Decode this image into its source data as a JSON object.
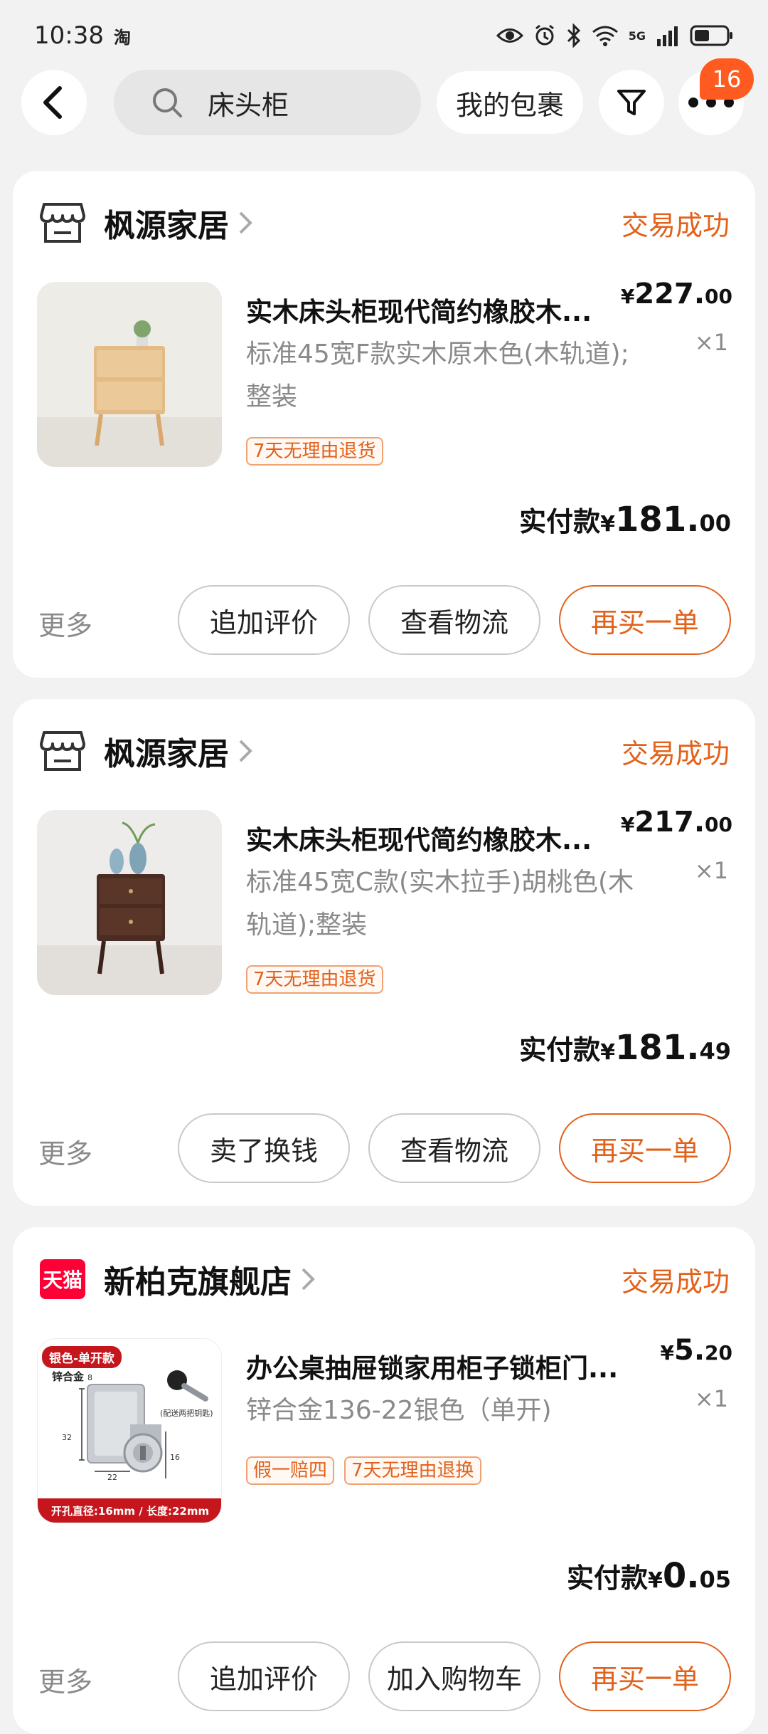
{
  "status_bar": {
    "time": "10:38",
    "app_indicator": "淘",
    "network": "5G",
    "icons": [
      "eye-icon",
      "alarm-icon",
      "bluetooth-icon",
      "wifi-icon",
      "signal-icon",
      "battery-icon"
    ]
  },
  "header": {
    "search_text": "床头柜",
    "my_packages": "我的包裹",
    "badge_count": "16",
    "accent": "#e2611b"
  },
  "orders": [
    {
      "shop_name": "枫源家居",
      "shop_icon": "store-icon",
      "status": "交易成功",
      "product_title": "实木床头柜现代简约橡胶木...",
      "sku": "标准45宽F款实木原木色(木轨道);整装",
      "tags": [
        "7天无理由退货"
      ],
      "price_symbol": "¥",
      "price_int": "227.",
      "price_dec": "00",
      "qty": "×1",
      "paid_label": "实付款",
      "paid_symbol": "¥",
      "paid_int": "181.",
      "paid_dec": "00",
      "more": "更多",
      "actions": [
        "追加评价",
        "查看物流",
        "再买一单"
      ]
    },
    {
      "shop_name": "枫源家居",
      "shop_icon": "store-icon",
      "status": "交易成功",
      "product_title": "实木床头柜现代简约橡胶木...",
      "sku": "标准45宽C款(实木拉手)胡桃色(木轨道);整装",
      "tags": [
        "7天无理由退货"
      ],
      "price_symbol": "¥",
      "price_int": "217.",
      "price_dec": "00",
      "qty": "×1",
      "paid_label": "实付款",
      "paid_symbol": "¥",
      "paid_int": "181.",
      "paid_dec": "49",
      "more": "更多",
      "actions": [
        "卖了换钱",
        "查看物流",
        "再买一单"
      ]
    },
    {
      "shop_name": "新柏克旗舰店",
      "shop_icon": "tmall-icon",
      "shop_logo_text": "天猫",
      "status": "交易成功",
      "product_title": "办公桌抽屉锁家用柜子锁柜门...",
      "sku": "锌合金136-22银色（单开)",
      "tags": [
        "假一赔四",
        "7天无理由退换"
      ],
      "price_symbol": "¥",
      "price_int": "5.",
      "price_dec": "20",
      "qty": "×1",
      "paid_label": "实付款",
      "paid_symbol": "¥",
      "paid_int": "0.",
      "paid_dec": "05",
      "more": "更多",
      "actions": [
        "追加评价",
        "加入购物车",
        "再买一单"
      ],
      "image_banner_top": "银色-单开款",
      "image_material": "锌合金",
      "image_note": "(配送两把钥匙)",
      "image_banner_bottom": "开孔直径:16mm / 长度:22mm",
      "image_dims": [
        "32",
        "22",
        "16",
        "8"
      ]
    }
  ]
}
